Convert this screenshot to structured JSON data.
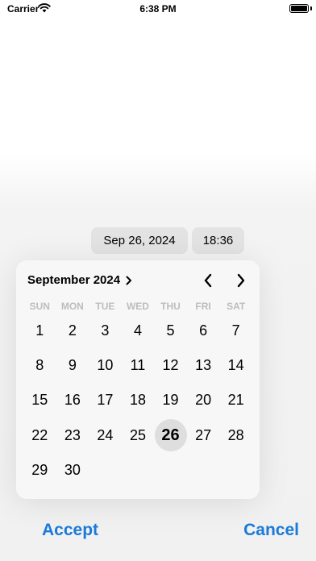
{
  "status_bar": {
    "carrier": "Carrier",
    "time": "6:38 PM",
    "icons": [
      "wifi-icon",
      "battery-icon"
    ]
  },
  "picker": {
    "date_value": "Sep 26, 2024",
    "time_value": "18:36"
  },
  "calendar": {
    "month_title": "September 2024",
    "weekdays": [
      "SUN",
      "MON",
      "TUE",
      "WED",
      "THU",
      "FRI",
      "SAT"
    ],
    "leading_blank_days": 0,
    "days": [
      "1",
      "2",
      "3",
      "4",
      "5",
      "6",
      "7",
      "8",
      "9",
      "10",
      "11",
      "12",
      "13",
      "14",
      "15",
      "16",
      "17",
      "18",
      "19",
      "20",
      "21",
      "22",
      "23",
      "24",
      "25",
      "26",
      "27",
      "28",
      "29",
      "30"
    ],
    "selected_day": "26",
    "icons": [
      "chevron-right-icon",
      "chevron-left-icon"
    ]
  },
  "actions": {
    "accept_label": "Accept",
    "cancel_label": "Cancel",
    "accent_color": "#1a7ad9"
  }
}
